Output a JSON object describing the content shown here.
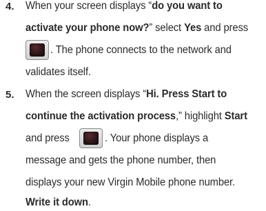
{
  "steps": [
    {
      "number": "4.",
      "lines": {
        "l1_a": "When your screen displays “",
        "l1_b": "do you want to",
        "l2_a": "activate your phone now?",
        "l2_b": "” select ",
        "l2_c": "Yes",
        "l2_d": " and press",
        "l3_a": ". The phone connects to the network and",
        "l4_a": "validates itself."
      },
      "key_icon": "ok-key-icon"
    },
    {
      "number": "5.",
      "lines": {
        "l1_a": "When the screen displays “",
        "l1_b": "Hi. Press Start to",
        "l2_a": "continue the activation process",
        "l2_b": ",” highlight ",
        "l2_c": "Start",
        "l3_a": "and press",
        "l3_b": ". Your phone displays a",
        "l4_a": "message and gets the phone number, then",
        "l5_a": "displays your new Virgin Mobile phone number.",
        "l6_a": "Write it down",
        "l6_b": "."
      },
      "key_icon": "ok-key-icon"
    }
  ]
}
